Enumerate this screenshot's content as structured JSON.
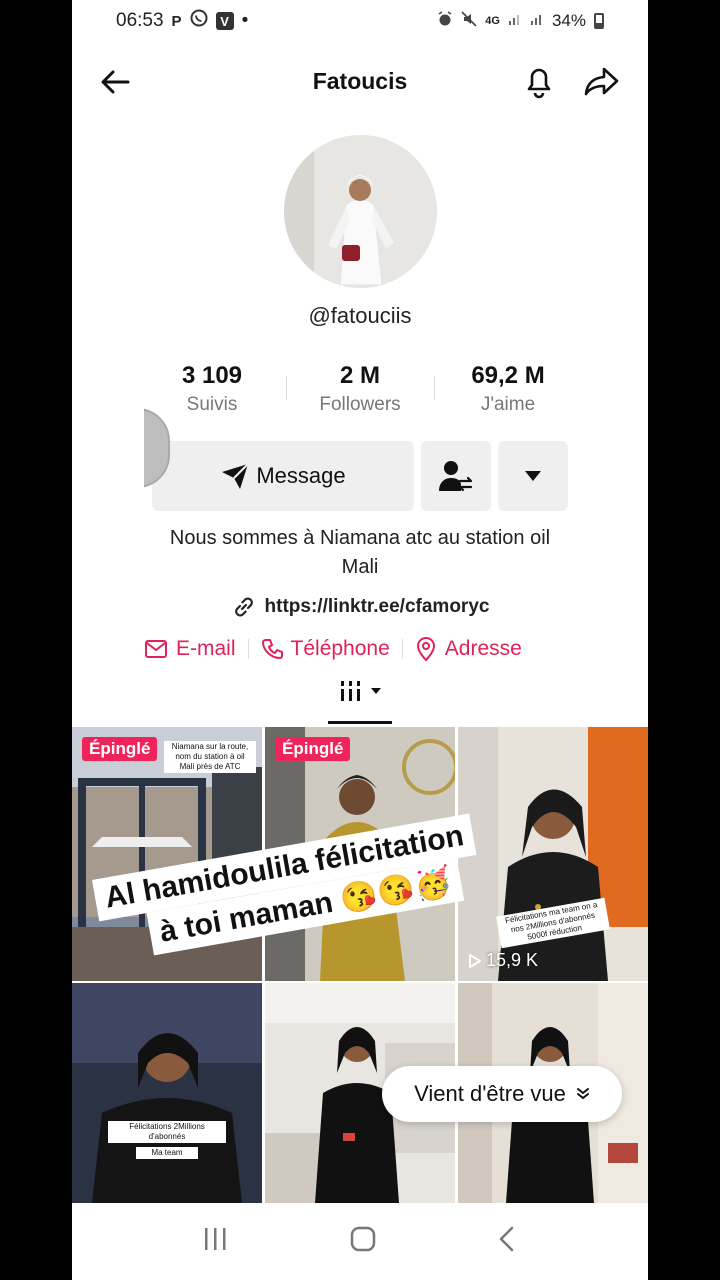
{
  "status_bar": {
    "time": "06:53",
    "notif_p": "P",
    "notif_v": "V",
    "net": "4G",
    "battery": "34%"
  },
  "header": {
    "title": "Fatoucis"
  },
  "profile": {
    "handle": "@fatouciis",
    "stats": [
      {
        "value": "3 109",
        "label": "Suivis"
      },
      {
        "value": "2 M",
        "label": "Followers"
      },
      {
        "value": "69,2 M",
        "label": "J'aime"
      }
    ],
    "message_label": "Message",
    "bio_line1": "Nous sommes à Niamana atc au station oil",
    "bio_line2": "Mali",
    "link": "https://linktr.ee/cfamoryc",
    "contacts": {
      "email": "E-mail",
      "phone": "Téléphone",
      "address": "Adresse"
    }
  },
  "grid": {
    "pinned_label": "Épinglé",
    "tile1_caption": "Niamana sur la route, nom du station à oil Mali près de ATC",
    "tile3_caption": "Félicitations ma team on a nos 2Millions d'abonnés 5000f réduction",
    "tile3_views": "15,9 K",
    "tile4_caption": "Félicitations 2Millions d'abonnés",
    "tile4_caption2": "Ma team"
  },
  "overlay": {
    "sticker_line1": "Al hamidoulila félicitation",
    "sticker_line2": "à toi maman 😘😘🥳",
    "just_watched": "Vient d'être vue"
  },
  "colors": {
    "accent": "#e0215b",
    "pin": "#f0245a"
  }
}
